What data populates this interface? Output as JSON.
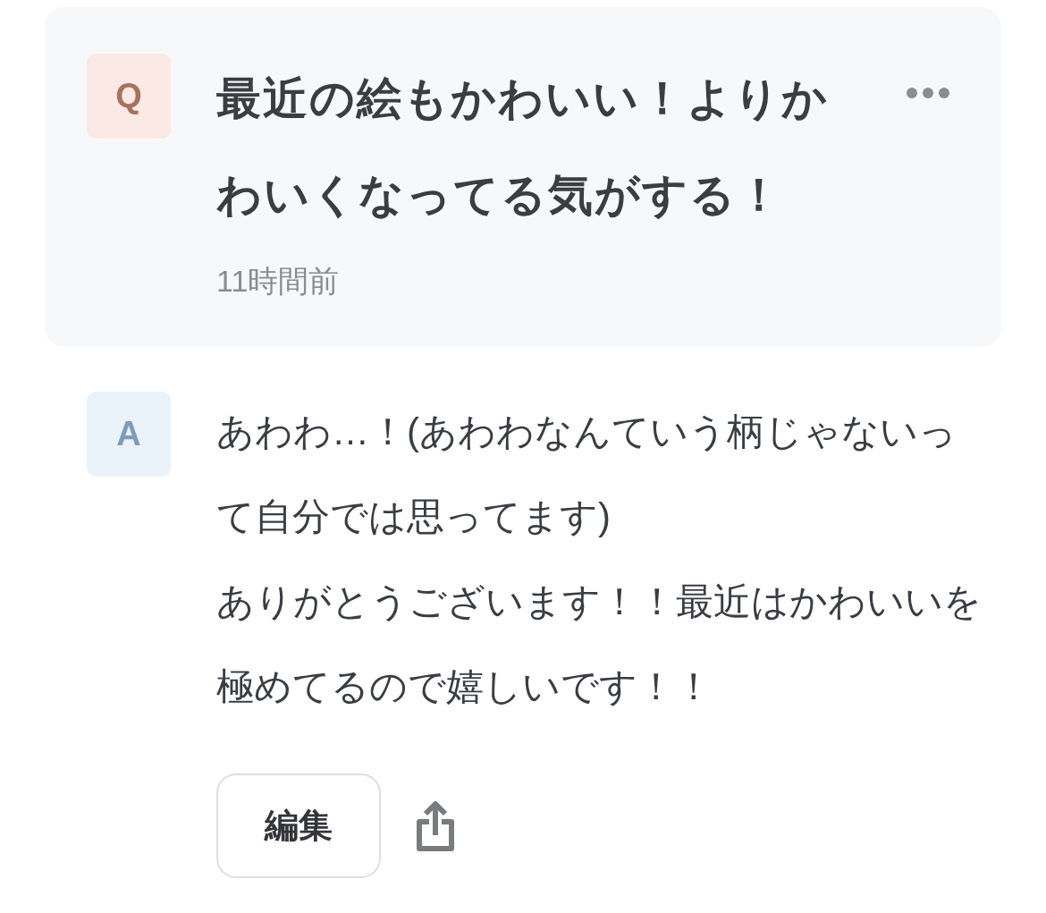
{
  "question": {
    "badge": "Q",
    "text": "最近の絵もかわいい！よりかわいくなってる気がする！",
    "time": "11時間前"
  },
  "answer": {
    "badge": "A",
    "paragraphs": [
      "あわわ…！(あわわなんていう柄じゃないって自分では思ってます)",
      "ありがとうございます！！最近はかわいいを極めてるので嬉しいです！！"
    ]
  },
  "actions": {
    "edit_button": "編集"
  }
}
